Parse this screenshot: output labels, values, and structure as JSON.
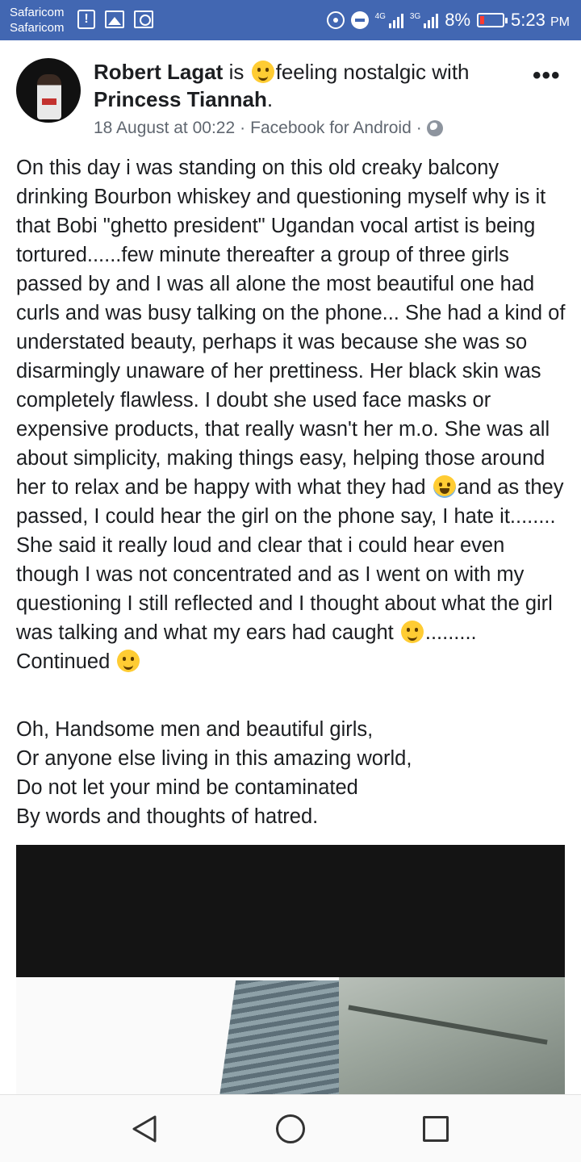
{
  "status_bar": {
    "carrier_1": "Safaricom",
    "carrier_2": "Safaricom",
    "alert_glyph": "!",
    "network_1": "4G",
    "network_2": "3G",
    "battery": "8%",
    "time": "5:23",
    "ampm": "PM",
    "background_color": "#4267b2"
  },
  "post": {
    "author": "Robert Lagat",
    "verb": "is",
    "feeling": "feeling nostalgic with",
    "tagged": "Princess Tiannah",
    "tagged_suffix": ".",
    "date": "18 August at 00:22",
    "separator": "·",
    "source": "Facebook for Android",
    "separator2": "·",
    "more_label": "•••",
    "body_main": "On this day i was standing on this old creaky balcony drinking Bourbon whiskey and questioning myself why is it that Bobi \"ghetto president\" Ugandan vocal artist is being tortured......few minute thereafter a group of three girls passed by and I was all alone the most beautiful one had curls and was busy talking on the phone... She had a kind of understated beauty, perhaps it was because she was so disarmingly unaware of her prettiness. Her black skin was completely flawless. I doubt she used face masks or expensive products, that really wasn't her m.o. She was all about simplicity, making things easy, helping those around her to relax and be happy with what they had",
    "body_part2": "and as they passed, I could hear the girl on the phone say, I hate it........ She said it really loud and clear that i could hear even though I was not concentrated and as I went on with my questioning I still reflected and I thought about what the girl was talking and what my ears had caught",
    "body_part3": "......... Continued",
    "poem": [
      "Oh, Handsome men and beautiful girls,",
      "Or anyone else living in this amazing world,",
      "Do not let your mind be contaminated",
      "By words and thoughts of hatred."
    ]
  },
  "icons": {
    "feeling": "smiling-emoji-icon",
    "privacy": "globe-icon",
    "nav_back": "back-triangle-icon",
    "nav_home": "home-circle-icon",
    "nav_recent": "recent-apps-square-icon"
  }
}
